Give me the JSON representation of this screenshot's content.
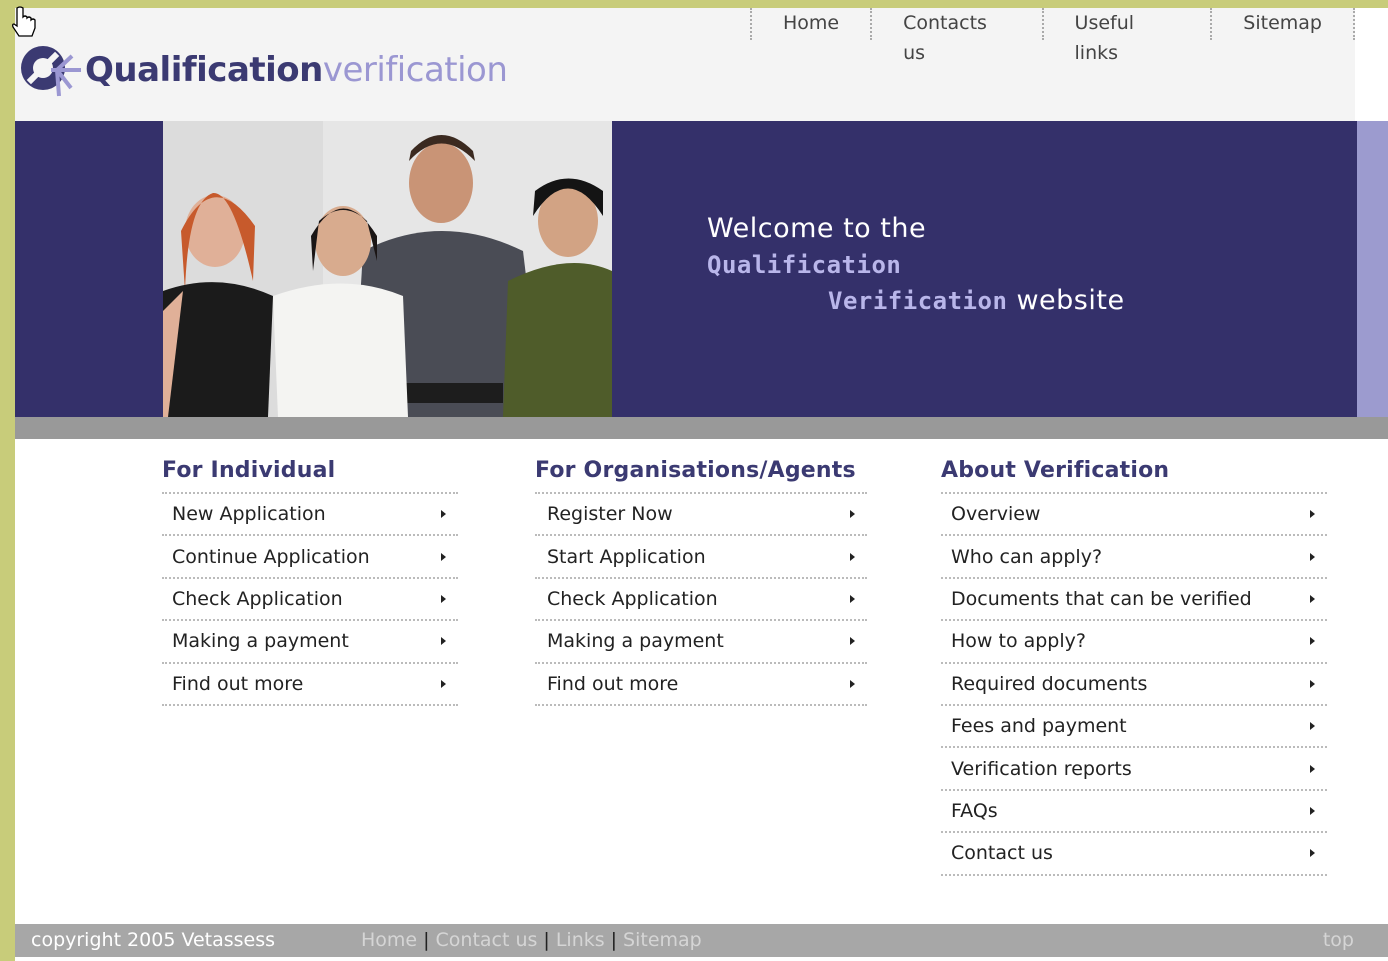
{
  "logo": {
    "strong": "Qualification",
    "light": "verification"
  },
  "topnav": [
    "Home",
    "Contacts us",
    "Useful links",
    "Sitemap"
  ],
  "banner": {
    "welcome_prefix": "Welcome to the ",
    "highlight1": "Qualification",
    "highlight2": "Verification",
    "welcome_suffix": " website"
  },
  "columns": {
    "individual": {
      "title": "For Individual",
      "items": [
        "New Application",
        "Continue Application",
        "Check Application",
        "Making a payment",
        "Find out more"
      ]
    },
    "organisations": {
      "title": "For Organisations/Agents",
      "items": [
        "Register Now",
        "Start Application",
        "Check Application",
        "Making a payment",
        "Find out more"
      ]
    },
    "about": {
      "title": "About Verification",
      "items": [
        "Overview",
        "Who can apply?",
        "Documents that can be verified",
        "How to apply?",
        "Required documents",
        "Fees and payment",
        "Verification reports",
        "FAQs",
        "Contact us"
      ]
    }
  },
  "footer": {
    "copyright": "copyright 2005 Vetassess",
    "links": [
      "Home",
      "Contact us",
      "Links",
      "Sitemap"
    ],
    "separator": "|",
    "top": "top"
  },
  "colors": {
    "banner": "#34306a",
    "brand": "#3b3a72",
    "brand_light": "#9b97d2",
    "accent_stripe": "#9c9bcf"
  },
  "icons": [
    "logo-star-icon",
    "arrow-right-icon",
    "hand-cursor-icon"
  ]
}
